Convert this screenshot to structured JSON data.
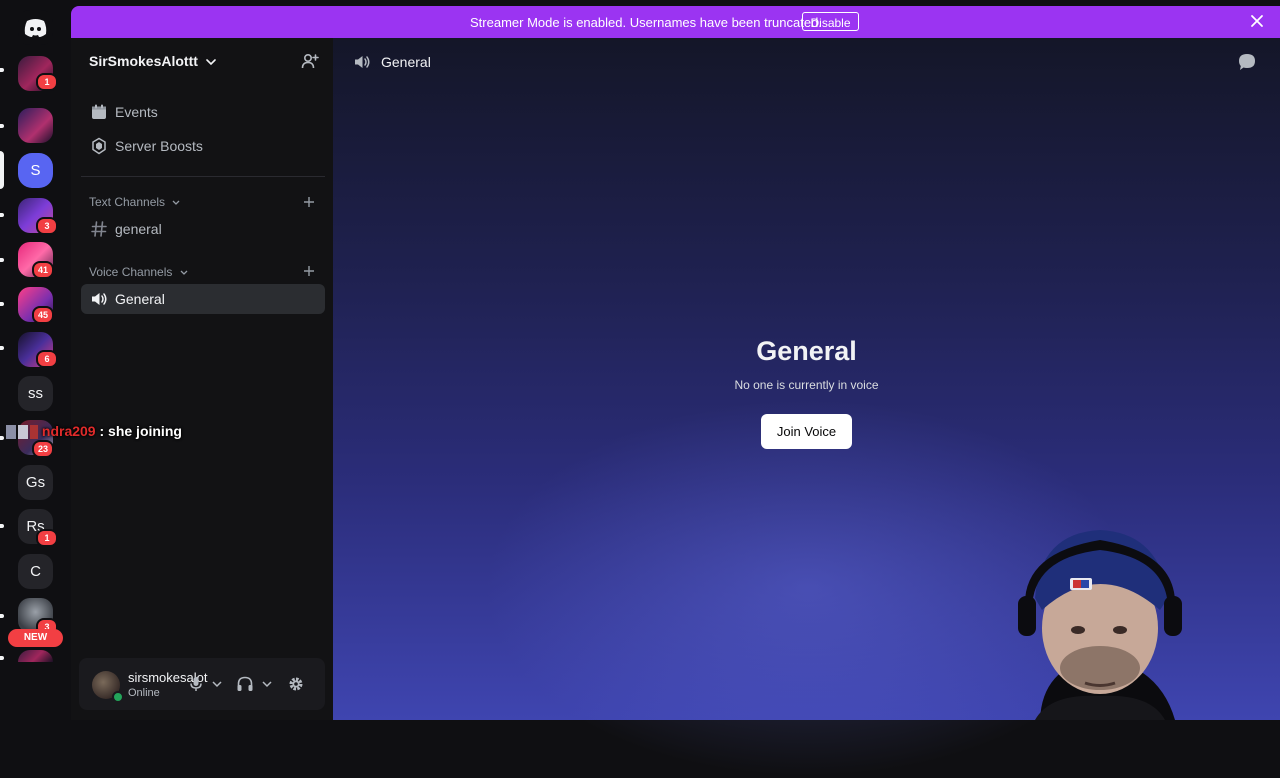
{
  "banner": {
    "text": "Streamer Mode is enabled. Usernames have been truncated.",
    "button_label": "Disable"
  },
  "servers": [
    {
      "name": "server-1",
      "badge": "1"
    },
    {
      "name": "server-2",
      "badge": ""
    },
    {
      "name": "S",
      "badge": "",
      "selected": true
    },
    {
      "name": "server-4",
      "badge": "3"
    },
    {
      "name": "server-5",
      "badge": "41"
    },
    {
      "name": "server-6",
      "badge": "45"
    },
    {
      "name": "server-7",
      "badge": "6"
    },
    {
      "name": "ss",
      "badge": ""
    },
    {
      "name": "server-9",
      "badge": "23"
    },
    {
      "name": "Gs",
      "badge": ""
    },
    {
      "name": "Rs",
      "badge": "1"
    },
    {
      "name": "C",
      "badge": ""
    },
    {
      "name": "server-13",
      "badge": "3"
    }
  ],
  "rail_new_label": "NEW",
  "sidebar": {
    "server_name": "SirSmokesAlottt",
    "events_label": "Events",
    "boosts_label": "Server Boosts",
    "text_category": "Text Channels",
    "text_channel": "general",
    "voice_category": "Voice Channels",
    "voice_channel": "General"
  },
  "user": {
    "name": "sirsmokesalot",
    "status": "Online"
  },
  "main": {
    "header_title": "General",
    "voice_title": "General",
    "voice_subtitle": "No one is currently in voice",
    "join_label": "Join Voice"
  },
  "overlay_chat": {
    "username": "ndra209",
    "message": ": she joining"
  },
  "colors": {
    "banner": "#9b34f2",
    "selected_server": "#5865f2",
    "badge": "#f23f43",
    "online": "#23a55a"
  }
}
